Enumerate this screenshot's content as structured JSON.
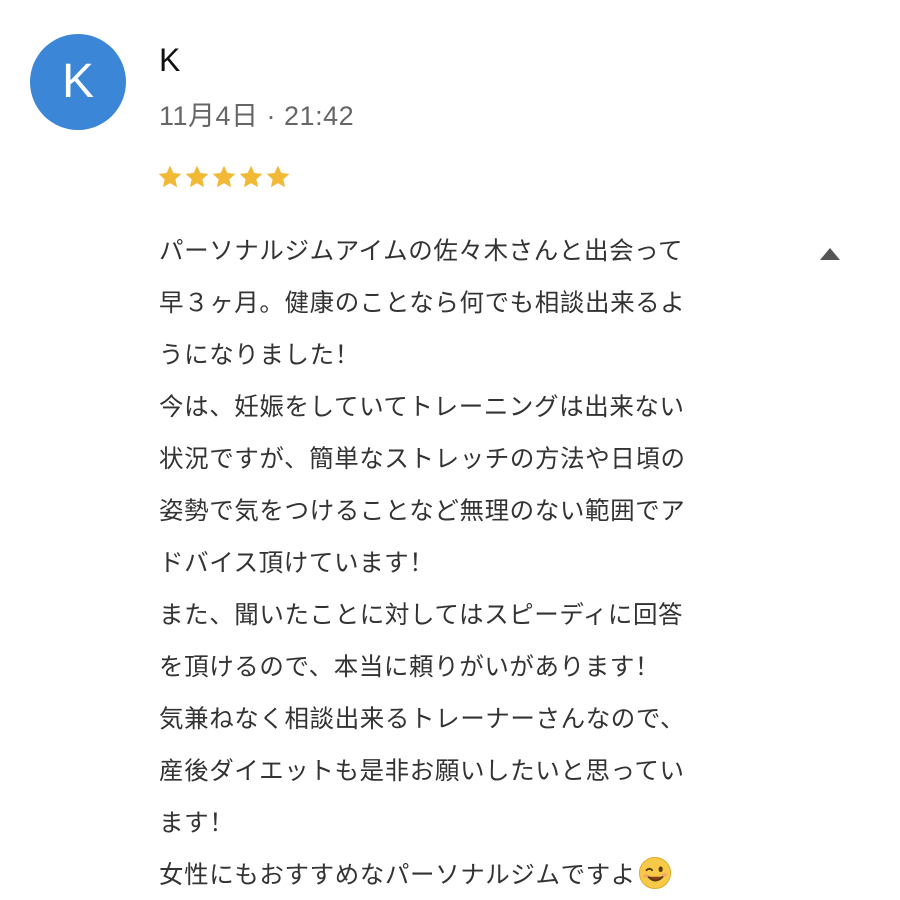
{
  "reviewer": {
    "initial": "K",
    "name": "K",
    "avatar_color": "#3b86d6"
  },
  "review": {
    "timestamp": "11月4日 · 21:42",
    "rating": 5,
    "rating_max": 5,
    "star_color": "#f2b936",
    "lines": [
      "パーソナルジムアイムの佐々木さんと出会って",
      "早３ヶ月。健康のことなら何でも相談出来るよ",
      "うになりました！",
      "今は、妊娠をしていてトレーニングは出来ない",
      "状況ですが、簡単なストレッチの方法や日頃の",
      "姿勢で気をつけることなど無理のない範囲でア",
      "ドバイス頂けています！",
      "また、聞いたことに対してはスピーディに回答",
      "を頂けるので、本当に頼りがいがあります！",
      "気兼ねなく相談出来るトレーナーさんなので、",
      "産後ダイエットも是非お願いしたいと思ってい",
      "ます！",
      "女性にもおすすめなパーソナルジムですよ"
    ],
    "trailing_emoji": "winking-face-icon"
  },
  "controls": {
    "collapse_icon": "triangle-up-icon"
  }
}
